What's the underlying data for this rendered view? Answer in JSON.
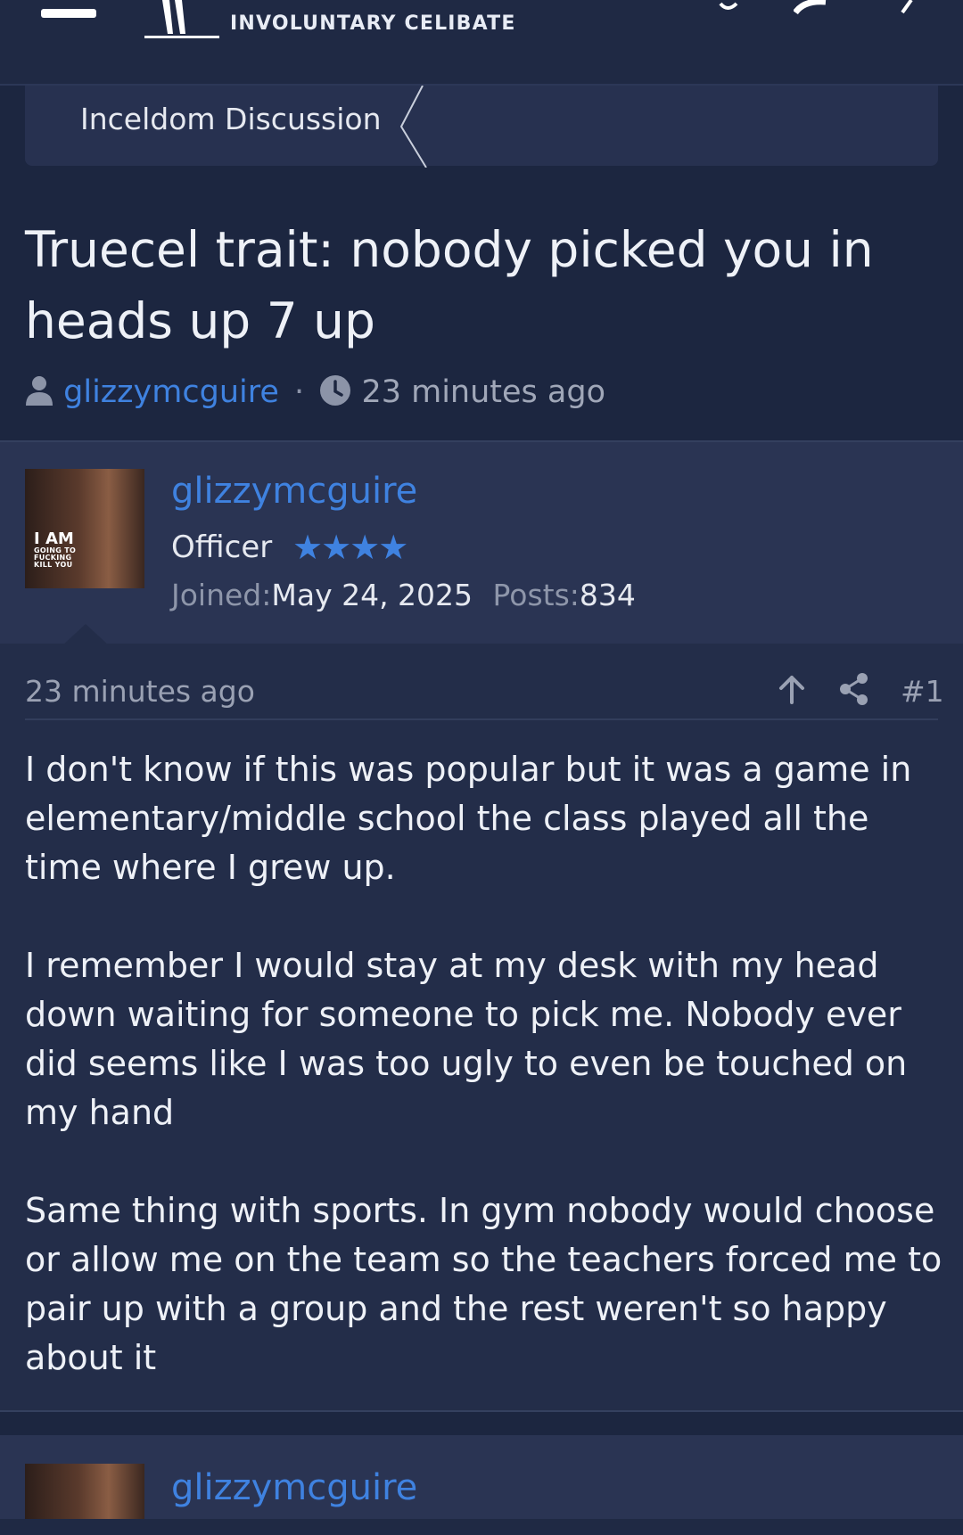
{
  "header": {
    "tagline": "INVOLUNTARY CELIBATE"
  },
  "breadcrumb": {
    "label": "Inceldom Discussion"
  },
  "thread": {
    "title": "Truecel trait: nobody picked you in heads up 7 up",
    "author": "glizzymcguire",
    "separator": "·",
    "time": "23 minutes ago"
  },
  "post": {
    "username": "glizzymcguire",
    "user_title": "Officer",
    "stars": "★★★★",
    "joined_label": "Joined:",
    "joined_value": "May 24, 2025",
    "posts_label": "Posts:",
    "posts_value": "834",
    "avatar_text_big": "I AM",
    "avatar_text_small": "GOING TO FUCKING KILL YOU",
    "time": "23 minutes ago",
    "number": "#1",
    "paragraphs": [
      "I don't know if this was popular but it was a game in elementary/middle school the class played all the time where I grew up.",
      "I remember I would stay at my desk with my head down waiting for someone to pick me. Nobody ever did seems like I was too ugly to even be touched on my hand",
      "Same thing with sports. In gym nobody would choose or allow me on the team so the teachers forced me to pair up with a group and the rest weren't so happy about it"
    ]
  },
  "next_post": {
    "username": "glizzymcguire"
  },
  "colors": {
    "link": "#3f82e0",
    "background": "#1c2640",
    "user_block": "#2a3453"
  },
  "icons": [
    "menu-icon",
    "user-icon",
    "clock-icon",
    "arrow-up-icon",
    "share-icon"
  ]
}
